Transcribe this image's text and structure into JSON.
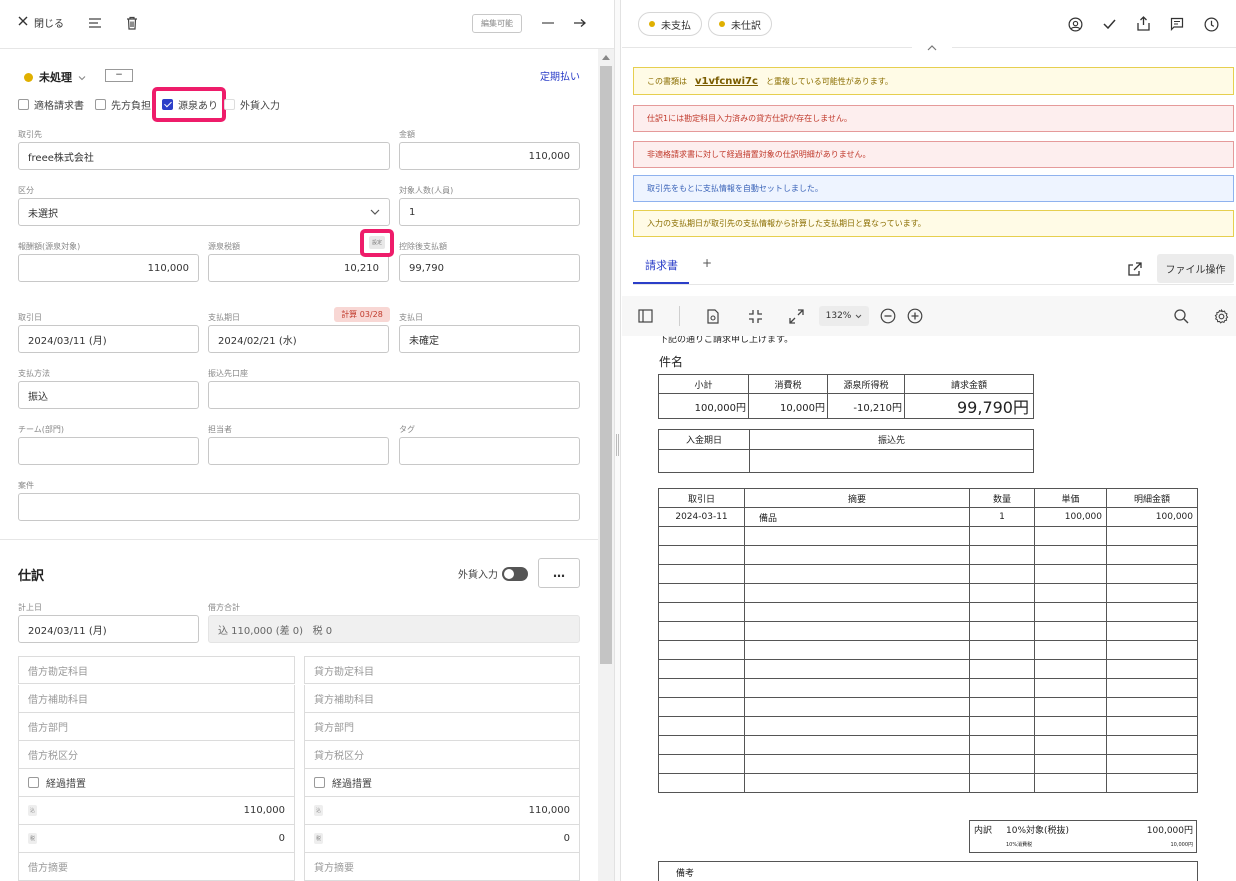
{
  "left_header": {
    "close_label": "閉じる",
    "edit_badge": "編集可能"
  },
  "status": {
    "label": "未処理",
    "minus": "−",
    "recurring_link": "定期払い",
    "color": "#e0b000"
  },
  "checkboxes": [
    {
      "label": "適格請求書",
      "checked": false
    },
    {
      "label": "先方負担",
      "checked": false
    },
    {
      "label": "源泉あり",
      "checked": true
    },
    {
      "label": "外貨入力",
      "checked": false
    }
  ],
  "form": {
    "partner": {
      "label": "取引先",
      "value": "freee株式会社"
    },
    "amount": {
      "label": "金額",
      "value": "110,000"
    },
    "category": {
      "label": "区分",
      "value": "未選択"
    },
    "people": {
      "label": "対象人数(人員)",
      "value": "1"
    },
    "remuneration": {
      "label": "報酬額(源泉対象)",
      "value": "110,000"
    },
    "withholding": {
      "label": "源泉税額",
      "value": "10,210",
      "set_badge": "設定"
    },
    "net_payment": {
      "label": "控除後支払額",
      "value": "99,790"
    },
    "deal_date": {
      "label": "取引日",
      "value": "2024/03/11 (月)"
    },
    "due_date": {
      "label": "支払期日",
      "value": "2024/02/21 (水)",
      "calc_badge": "計算 03/28"
    },
    "pay_date": {
      "label": "支払日",
      "value": "未確定"
    },
    "pay_method": {
      "label": "支払方法",
      "value": "振込"
    },
    "bank_account": {
      "label": "振込先口座",
      "value": ""
    },
    "team": {
      "label": "チーム(部門)",
      "value": ""
    },
    "assignee": {
      "label": "担当者",
      "value": ""
    },
    "tag": {
      "label": "タグ",
      "value": ""
    },
    "project": {
      "label": "案件",
      "value": ""
    }
  },
  "journal": {
    "title": "仕訳",
    "fx_toggle_label": "外貨入力",
    "more_label": "…",
    "posting_date": {
      "label": "計上日",
      "value": "2024/03/11 (月)"
    },
    "debit_total": {
      "label": "借方合計",
      "value": "込 110,000 (差 0)   税 0"
    },
    "debit": {
      "account": "借方勘定科目",
      "sub_account": "借方補助科目",
      "department": "借方部門",
      "tax_category": "借方税区分",
      "transitional": "経過措置",
      "amount_badge": "込",
      "amount": "110,000",
      "tax_badge": "税",
      "tax": "0",
      "memo": "借方摘要"
    },
    "credit": {
      "account": "貸方勘定科目",
      "sub_account": "貸方補助科目",
      "department": "貸方部門",
      "tax_category": "貸方税区分",
      "transitional": "経過措置",
      "amount_badge": "込",
      "amount": "110,000",
      "tax_badge": "税",
      "tax": "0",
      "memo": "貸方摘要"
    }
  },
  "right_header": {
    "tags": [
      {
        "label": "未支払",
        "color": "#e0b000"
      },
      {
        "label": "未仕訳",
        "color": "#e0b000"
      }
    ]
  },
  "banners": [
    {
      "type": "warning",
      "prefix": "この書類は",
      "link": "v1vfcnwi7c",
      "suffix": "と重複している可能性があります。"
    },
    {
      "type": "error",
      "text": "仕訳1には勘定科目入力済みの貸方仕訳が存在しません。"
    },
    {
      "type": "error",
      "text": "非適格請求書に対して経過措置対象の仕訳明細がありません。"
    },
    {
      "type": "info",
      "text": "取引先をもとに支払情報を自動セットしました。"
    },
    {
      "type": "warning",
      "text": "入力の支払期日が取引先の支払情報から計算した支払期日と異なっています。"
    }
  ],
  "doc_tabs": {
    "active": "請求書",
    "add": "+",
    "file_ops": "ファイル操作"
  },
  "viewer": {
    "zoom": "132%"
  },
  "invoice": {
    "cut_text": "下記の通りご請求申し上げます。",
    "subject": "件名",
    "summary_headers": [
      "小計",
      "消費税",
      "源泉所得税",
      "請求金額"
    ],
    "summary_values": [
      "100,000円",
      "10,000円",
      "-10,210円",
      "99,790円"
    ],
    "bank_headers": [
      "入金期日",
      "振込先"
    ],
    "detail_headers": [
      "取引日",
      "摘要",
      "数量",
      "単価",
      "明細金額"
    ],
    "detail_rows": [
      [
        "2024-03-11",
        "備品",
        "1",
        "100,000",
        "100,000"
      ]
    ],
    "tax_box": {
      "label": "内訳",
      "category": "10%対象(税抜)",
      "amount": "100,000円",
      "sub_label": "10%消費税",
      "sub_amount": "10,000円"
    },
    "notes_label": "備考"
  },
  "colors": {
    "accent": "#2b3ec8",
    "highlight": "#ee1c6a"
  }
}
